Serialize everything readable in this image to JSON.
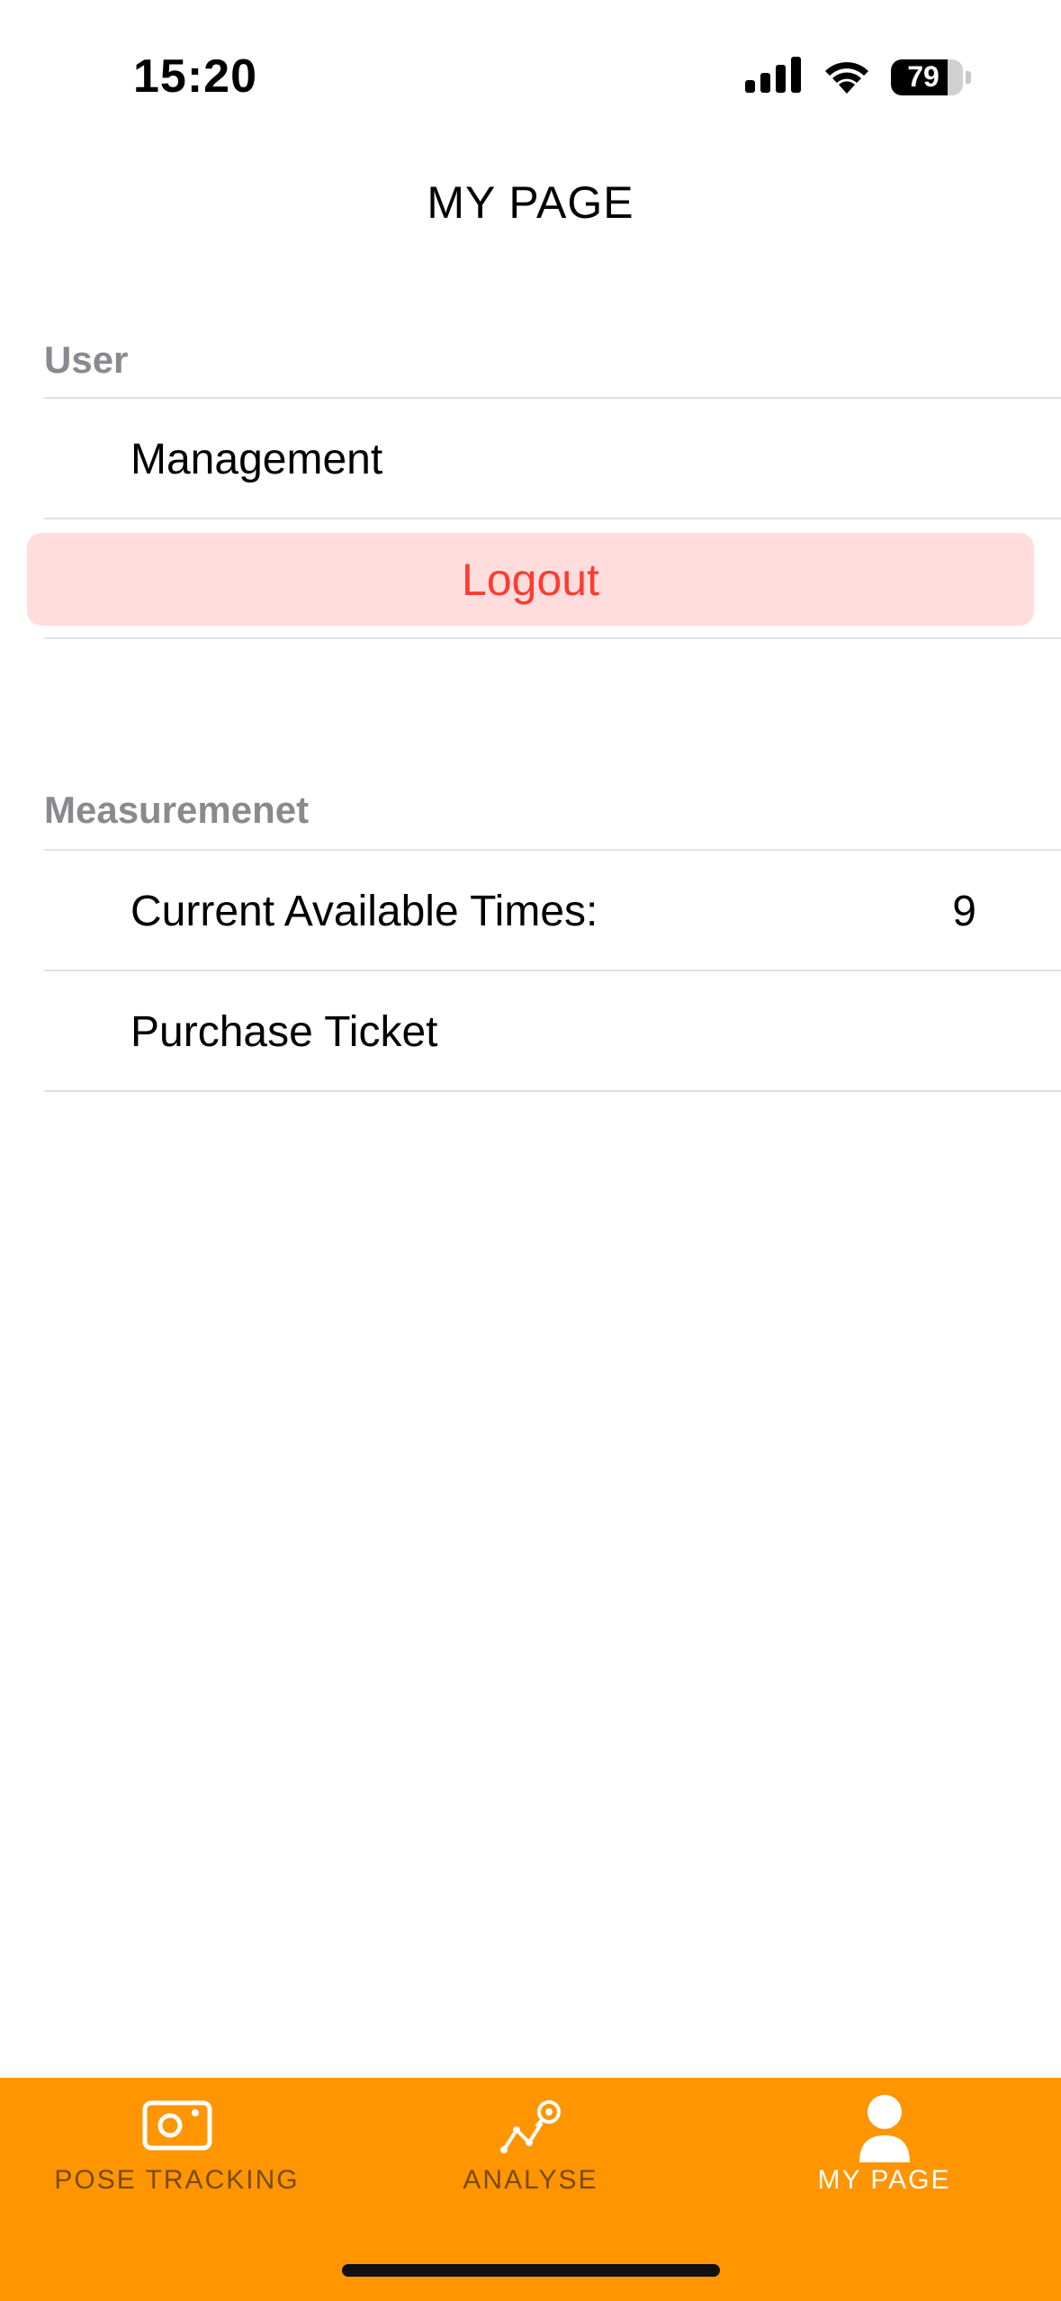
{
  "status_bar": {
    "time": "15:20",
    "battery": "79",
    "battery_fill": 0.79,
    "icons": [
      "cellular-signal-icon",
      "wifi-icon",
      "battery-icon"
    ]
  },
  "nav": {
    "title": "MY PAGE"
  },
  "sections": {
    "user": {
      "header": "User",
      "management_label": "Management",
      "logout_label": "Logout"
    },
    "measurement": {
      "header": "Measuremenet",
      "available_label": "Current Available Times:",
      "available_value": "9",
      "purchase_label": "Purchase Ticket"
    }
  },
  "tab_bar": {
    "background": "#ff9500",
    "tabs": [
      {
        "label": "POSE TRACKING",
        "icon": "camera-icon",
        "active": false
      },
      {
        "label": "ANALYSE",
        "icon": "chart-search-icon",
        "active": false
      },
      {
        "label": "MY PAGE",
        "icon": "person-icon",
        "active": true
      }
    ]
  },
  "colors": {
    "logout_text": "#ff3b30",
    "logout_background": "#ffdddd",
    "section_header": "#8a8a8e",
    "active_tab_label": "#ffffff"
  }
}
